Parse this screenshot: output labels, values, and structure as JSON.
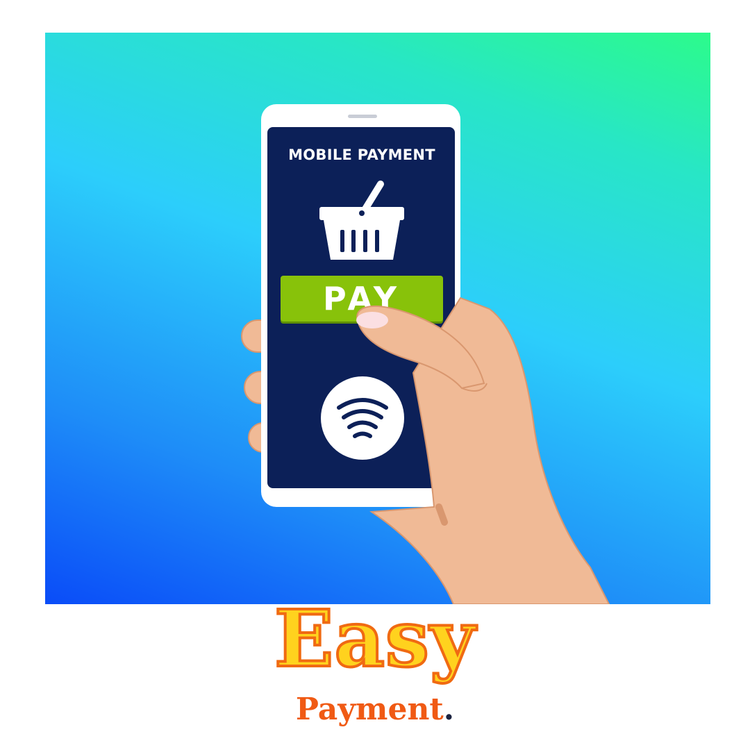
{
  "screen": {
    "title": "MOBILE PAYMENT",
    "pay_label": "PAY"
  },
  "headline": {
    "big": "Easy",
    "sub": "Payment",
    "period": "."
  },
  "icons": [
    "shopping-basket-icon",
    "contactless-icon",
    "phone-speaker-icon"
  ],
  "colors": {
    "background_start": "#0a4cf8",
    "background_end": "#2cfb8b",
    "screen": "#0c2058",
    "pay_button": "#88c20a",
    "skin": "#f0ba96",
    "easy_fill": "#ffd21e",
    "easy_outline": "#f06a12",
    "payment_text": "#f05a14"
  }
}
